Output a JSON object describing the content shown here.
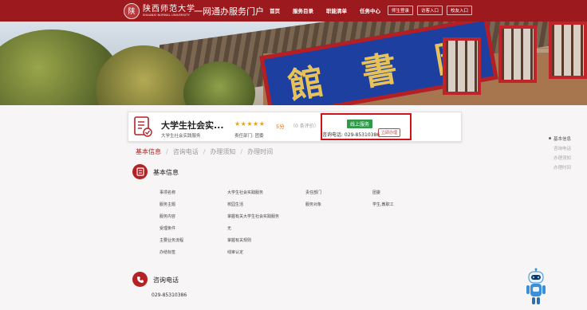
{
  "header": {
    "seal_char": "陕",
    "university_cn": "陕西师范大学",
    "university_en": "SHAANXI NORMAL UNIVERSITY",
    "portal_title": "一网通办服务门户",
    "nav": [
      "首页",
      "服务目录",
      "职能清单",
      "任务中心"
    ],
    "login_buttons": [
      "师生登录",
      "访客入口",
      "校友入口"
    ]
  },
  "hero": {
    "plaque_chars": [
      "館",
      "書",
      "圖"
    ]
  },
  "service": {
    "title": "大学生社会实...",
    "subtitle": "大学生社会实践服务",
    "stars": "★★★★★",
    "score": "5分",
    "review_count": "（0 条评价）",
    "dept": "责任部门: 团委",
    "online_badge": "线上服务",
    "phone_line": "咨询电话: 029-85310386",
    "apply_label": "立即办理"
  },
  "tabs": [
    {
      "label": "基本信息",
      "active": true
    },
    {
      "label": "咨询电话",
      "active": false
    },
    {
      "label": "办理须知",
      "active": false
    },
    {
      "label": "办理时间",
      "active": false
    }
  ],
  "basic_info": {
    "title": "基本信息",
    "rows": [
      [
        "事项名称",
        "大学生社会实践服务",
        "责任部门",
        "团委"
      ],
      [
        "服务主题",
        "校园生活",
        "服务对象",
        "学生,教职工"
      ],
      [
        "服务内容",
        "掌握有关大学生社会实践服务",
        "",
        ""
      ],
      [
        "受理条件",
        "无",
        "",
        ""
      ],
      [
        "主要业务流程",
        "掌握有关规则",
        "",
        ""
      ],
      [
        "办结标签",
        "线审认定",
        "",
        ""
      ]
    ]
  },
  "consult": {
    "title": "咨询电话",
    "phone": "029-85310386"
  },
  "sidenav": [
    {
      "label": "基本信息",
      "active": true
    },
    {
      "label": "咨询电话",
      "active": false
    },
    {
      "label": "办理须知",
      "active": false
    },
    {
      "label": "办理时间",
      "active": false
    }
  ],
  "colors": {
    "brand": "#9c1a1d",
    "accent": "#b32226",
    "online": "#2f9b4a",
    "star": "#e6a11a"
  }
}
